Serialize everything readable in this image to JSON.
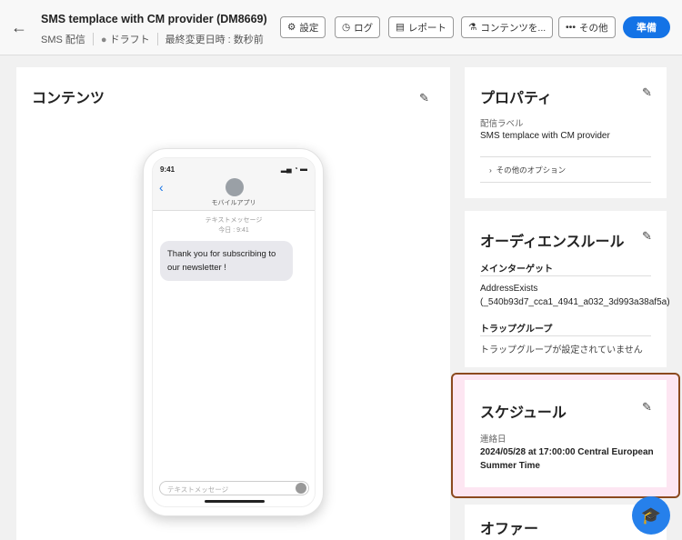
{
  "header": {
    "title": "SMS templace with CM provider (DM8669)",
    "channel": "SMS 配信",
    "status": "ドラフト",
    "modified": "最終変更日時 : 数秒前",
    "buttons": [
      "設定",
      "ログ",
      "レポート",
      "コンテンツを...",
      "その他"
    ],
    "primary": "準備"
  },
  "content": {
    "title": "コンテンツ",
    "phone": {
      "time": "9:41",
      "contact": "モバイルアプリ",
      "thread_label": "テキストメッセージ",
      "thread_time": "今日 : 9:41",
      "message": "Thank you for subscribing to our newsletter !",
      "input_placeholder": "テキストメッセージ"
    }
  },
  "properties": {
    "title": "プロパティ",
    "label_caption": "配信ラベル",
    "label_value": "SMS templace with CM provider",
    "more": "その他のオプション"
  },
  "audience": {
    "title": "オーディエンスルール",
    "main_target": "メインターゲット",
    "main_value": "AddressExists (_540b93d7_cca1_4941_a032_3d993a38af5a)",
    "trap": "トラップグループ",
    "trap_value": "トラップグループが設定されていません"
  },
  "schedule": {
    "title": "スケジュール",
    "caption": "連絡日",
    "value": "2024/05/28 at  17:00:00 Central European Summer Time"
  },
  "offer": {
    "title": "オファー"
  },
  "colors": {
    "accent": "#1473e6",
    "highlight": "#8b4a1f"
  }
}
